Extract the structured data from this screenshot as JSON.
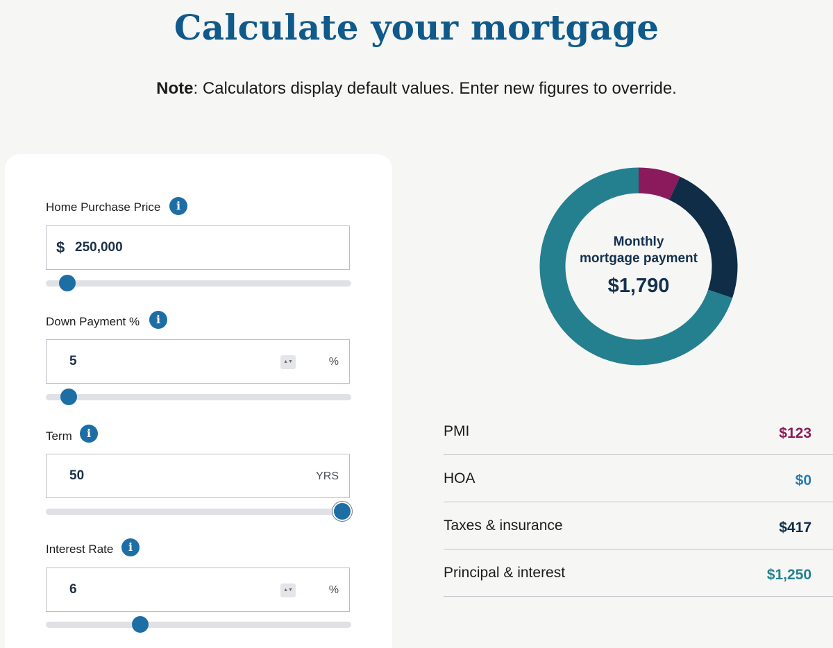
{
  "header": {
    "title": "Calculate your mortgage",
    "note_bold": "Note",
    "note_text": ": Calculators display default values. Enter new figures to override."
  },
  "form": {
    "home_price": {
      "label": "Home Purchase Price",
      "prefix": "$",
      "value": "250,000",
      "slider_fraction": 0.07
    },
    "down_payment": {
      "label": "Down Payment %",
      "value": "5",
      "unit": "%",
      "slider_fraction": 0.075
    },
    "term": {
      "label": "Term",
      "value": "50",
      "unit": "YRS",
      "slider_fraction": 0.97
    },
    "interest_rate": {
      "label": "Interest Rate",
      "value": "6",
      "unit": "%",
      "slider_fraction": 0.31
    },
    "info_glyph": "i",
    "stepper_glyph": "▲▼"
  },
  "summary": {
    "caption_line1": "Monthly",
    "caption_line2": "mortgage payment",
    "total": "$1,790",
    "donut_segments": [
      {
        "name": "PMI",
        "value": 123,
        "color": "#8b1a5c"
      },
      {
        "name": "HOA",
        "value": 0,
        "color": "#2a7ab8"
      },
      {
        "name": "Taxes & insurance",
        "value": 417,
        "color": "#0f2d47"
      },
      {
        "name": "Principal & interest",
        "value": 1250,
        "color": "#24808f"
      }
    ],
    "rows": [
      {
        "label": "PMI",
        "amount": "$123",
        "color": "#8b1a5c"
      },
      {
        "label": "HOA",
        "amount": "$0",
        "color": "#2a7ab8"
      },
      {
        "label": "Taxes & insurance",
        "amount": "$417",
        "color": "#0f2d47"
      },
      {
        "label": "Principal & interest",
        "amount": "$1,250",
        "color": "#24808f"
      }
    ]
  }
}
